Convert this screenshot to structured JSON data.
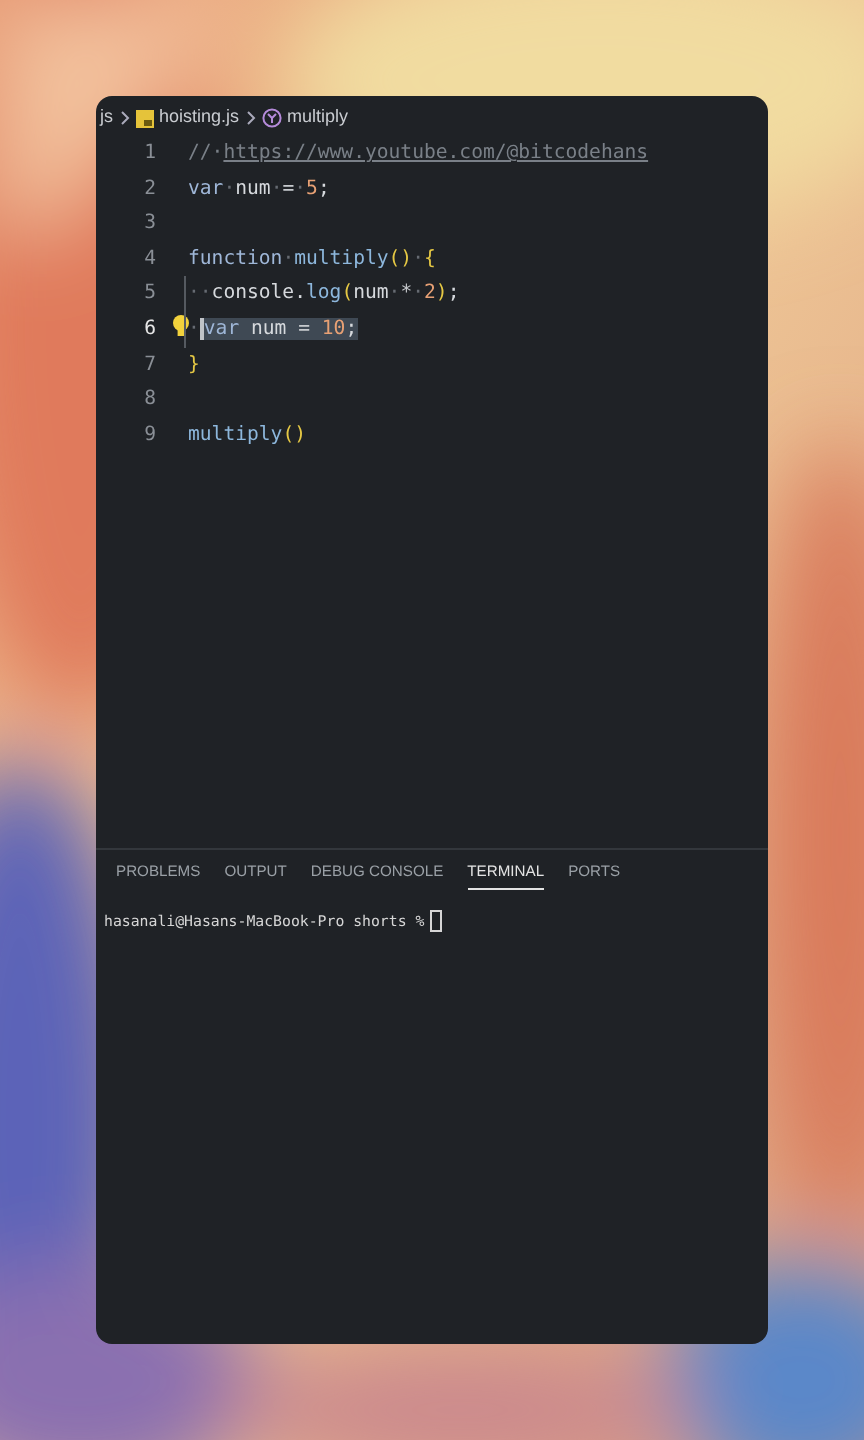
{
  "breadcrumb": {
    "folder": "js",
    "file": "hoisting.js",
    "symbol": "multiply"
  },
  "editor": {
    "lines": [
      {
        "number": "1",
        "current": false,
        "lightbulb": false,
        "indent_guide": false,
        "tokens": [
          {
            "text": "//·",
            "kind": "comment"
          },
          {
            "text": "https://www.youtube.com/@bitcodehans",
            "kind": "link"
          }
        ]
      },
      {
        "number": "2",
        "current": false,
        "lightbulb": false,
        "indent_guide": false,
        "tokens": [
          {
            "text": "var",
            "kind": "keyword"
          },
          {
            "text": "·",
            "kind": "space"
          },
          {
            "text": "num",
            "kind": "plain"
          },
          {
            "text": "·",
            "kind": "space"
          },
          {
            "text": "=",
            "kind": "operator"
          },
          {
            "text": "·",
            "kind": "space"
          },
          {
            "text": "5",
            "kind": "number"
          },
          {
            "text": ";",
            "kind": "plain"
          }
        ]
      },
      {
        "number": "3",
        "current": false,
        "lightbulb": false,
        "indent_guide": false
      },
      {
        "number": "4",
        "current": false,
        "lightbulb": false,
        "indent_guide": false,
        "tokens": [
          {
            "text": "function",
            "kind": "keyword"
          },
          {
            "text": "·",
            "kind": "space"
          },
          {
            "text": "multiply",
            "kind": "function"
          },
          {
            "text": "()",
            "kind": "bracket"
          },
          {
            "text": "·",
            "kind": "space"
          },
          {
            "text": "{",
            "kind": "bracket"
          }
        ]
      },
      {
        "number": "5",
        "current": false,
        "lightbulb": false,
        "indent_guide": true,
        "tokens": [
          {
            "text": "··",
            "kind": "space"
          },
          {
            "text": "console.",
            "kind": "plain"
          },
          {
            "text": "log",
            "kind": "function"
          },
          {
            "text": "(",
            "kind": "bracket"
          },
          {
            "text": "num",
            "kind": "plain"
          },
          {
            "text": "·",
            "kind": "space"
          },
          {
            "text": "*",
            "kind": "operator"
          },
          {
            "text": "·",
            "kind": "space"
          },
          {
            "text": "2",
            "kind": "number"
          },
          {
            "text": ")",
            "kind": "bracket"
          },
          {
            "text": ";",
            "kind": "plain"
          }
        ]
      },
      {
        "number": "6",
        "current": true,
        "lightbulb": true,
        "indent_guide": true,
        "tokens": [
          {
            "text": "·",
            "kind": "space"
          }
        ],
        "selection": [
          {
            "text": "var",
            "kind": "keyword"
          },
          {
            "text": " num ",
            "kind": "plain"
          },
          {
            "text": "=",
            "kind": "operator"
          },
          {
            "text": " 10",
            "kind": "number"
          },
          {
            "text": ";",
            "kind": "plain"
          }
        ]
      },
      {
        "number": "7",
        "current": false,
        "lightbulb": false,
        "indent_guide": false,
        "tokens": [
          {
            "text": "}",
            "kind": "bracket"
          }
        ]
      },
      {
        "number": "8",
        "current": false,
        "lightbulb": false,
        "indent_guide": false
      },
      {
        "number": "9",
        "current": false,
        "lightbulb": false,
        "indent_guide": false,
        "tokens": [
          {
            "text": "multiply",
            "kind": "function"
          },
          {
            "text": "()",
            "kind": "bracket"
          }
        ]
      }
    ]
  },
  "panel": {
    "tabs": [
      {
        "label": "PROBLEMS",
        "selected": false
      },
      {
        "label": "OUTPUT",
        "selected": false
      },
      {
        "label": "DEBUG CONSOLE",
        "selected": false
      },
      {
        "label": "TERMINAL",
        "selected": true
      },
      {
        "label": "PORTS",
        "selected": false
      }
    ],
    "terminal": {
      "prompt": "hasanali@Hasans-MacBook-Pro shorts %"
    }
  }
}
